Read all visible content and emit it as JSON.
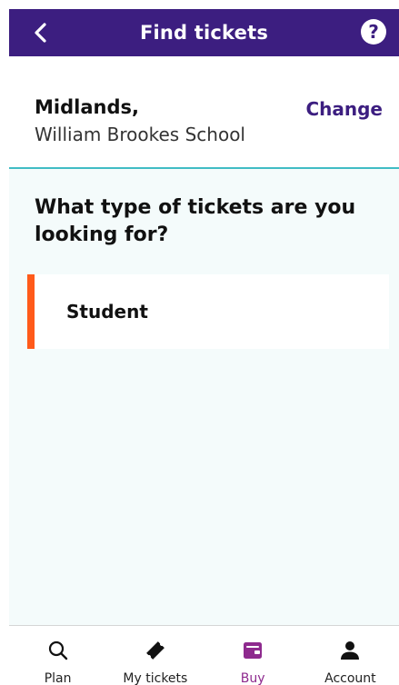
{
  "header": {
    "title": "Find tickets",
    "back_icon": "chevron-left-icon",
    "help_icon": "question-mark-icon",
    "help_glyph": "?"
  },
  "location": {
    "region": "Midlands,",
    "school": "William Brookes School",
    "change_label": "Change"
  },
  "question": "What type of tickets are you looking for?",
  "options": [
    {
      "label": "Student"
    }
  ],
  "bottom_nav": {
    "active": "Buy",
    "items": [
      {
        "label": "Plan",
        "icon": "search-icon"
      },
      {
        "label": "My tickets",
        "icon": "ticket-icon"
      },
      {
        "label": "Buy",
        "icon": "wallet-icon"
      },
      {
        "label": "Account",
        "icon": "person-icon"
      }
    ]
  },
  "colors": {
    "brand": "#3c1e80",
    "accent": "#ff5a1a",
    "active_nav": "#8e2a8e",
    "divider": "#40bcc4"
  }
}
